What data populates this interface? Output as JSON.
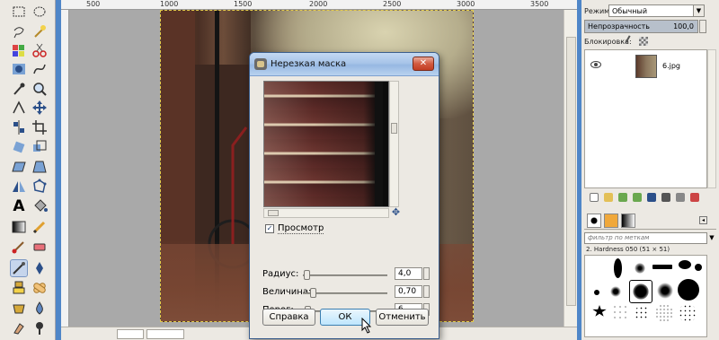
{
  "ruler": {
    "ticks": [
      "500",
      "1000",
      "1500",
      "2000",
      "2500",
      "3000",
      "3500"
    ]
  },
  "dialog": {
    "title": "Нерезкая маска",
    "close_label": "✕",
    "preview_label": "Просмотр",
    "preview_checked": true,
    "params": [
      {
        "label": "Радиус:",
        "value": "4,0"
      },
      {
        "label": "Величина:",
        "value": "0,70"
      },
      {
        "label": "Порог:",
        "value": "6"
      }
    ],
    "buttons": {
      "help": "Справка",
      "ok": "ОК",
      "cancel": "Отменить"
    }
  },
  "dock": {
    "mode_label": "Режим:",
    "mode_value": "Обычный",
    "opacity_label": "Непрозрачность",
    "opacity_value": "100,0",
    "lock_label": "Блокировка:",
    "layer_name": "6.jpg",
    "filter_placeholder": "фильтр по меткам",
    "brush_name": "2. Hardness 050 (51 × 51)"
  },
  "colors": {
    "accent": "#4f86c8",
    "selection_border": "#e4cc4a",
    "dialog_frame": "#3c5f8e"
  },
  "icons": [
    "rect-select-icon",
    "ellipse-select-icon",
    "lasso-icon",
    "fuzzy-select-icon",
    "by-color-select-icon",
    "scissors-icon",
    "foreground-select-icon",
    "paths-icon",
    "color-picker-icon",
    "zoom-icon",
    "measure-icon",
    "move-icon",
    "align-icon",
    "crop-icon",
    "rotate-icon",
    "scale-icon",
    "shear-icon",
    "perspective-icon",
    "flip-icon",
    "cage-icon",
    "text-icon",
    "bucket-fill-icon",
    "blend-icon",
    "pencil-icon",
    "paintbrush-icon",
    "eraser-icon",
    "airbrush-icon",
    "ink-icon",
    "clone-icon",
    "heal-icon",
    "perspective-clone-icon",
    "blur-icon",
    "smudge-icon",
    "dodge-burn-icon"
  ]
}
